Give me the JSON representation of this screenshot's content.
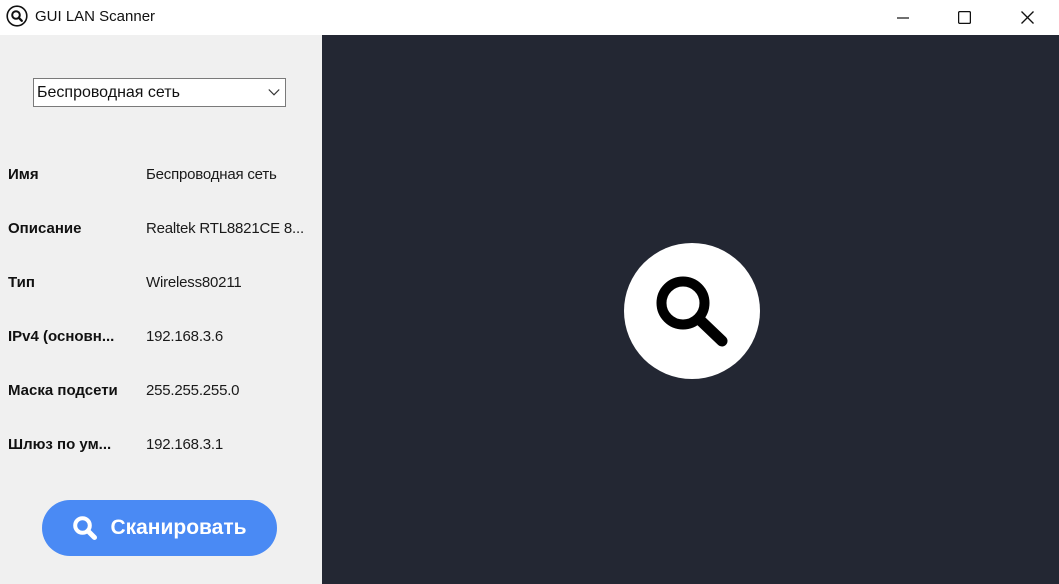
{
  "window": {
    "title": "GUI LAN Scanner",
    "app_icon": "search-icon",
    "controls": {
      "minimize_icon": "minimize-icon",
      "maximize_icon": "maximize-icon",
      "close_icon": "close-icon"
    }
  },
  "adapter_select": {
    "selected": "Беспроводная сеть",
    "icon": "chevron-down-icon"
  },
  "adapter_info": [
    {
      "label": "Имя",
      "value": "Беспроводная сеть"
    },
    {
      "label": "Описание",
      "value": "Realtek RTL8821CE 8..."
    },
    {
      "label": "Тип",
      "value": "Wireless80211"
    },
    {
      "label": "IPv4 (основн...",
      "value": "192.168.3.6"
    },
    {
      "label": "Маска подсети",
      "value": "255.255.255.0"
    },
    {
      "label": "Шлюз по ум...",
      "value": "192.168.3.1"
    }
  ],
  "scan_button": {
    "label": "Сканировать",
    "icon": "search-icon"
  },
  "placeholder": {
    "icon": "search-icon"
  },
  "colors": {
    "accent": "#4a8af4",
    "dark_panel": "#232733",
    "side_panel": "#f0f0f0"
  }
}
